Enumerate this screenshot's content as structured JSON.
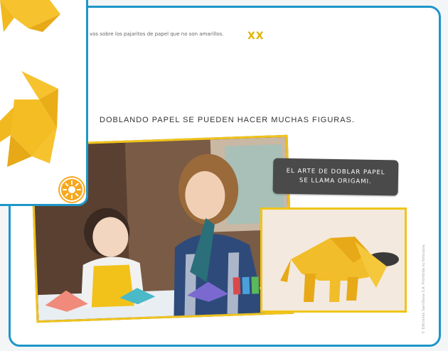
{
  "instruction": {
    "text": "vos sobre los pajaritos de papel que no son amarillos.",
    "answer_marks": "XX"
  },
  "headline": "DOBLANDO PAPEL SE PUEDEN HACER MUCHAS FIGURAS.",
  "caption": {
    "line1": "EL ARTE DE DOBLAR PAPEL",
    "line2": "SE LLAMA ORIGAMI."
  },
  "credit": "© Ediciones Santillana S.A. Prohibida su fotocopia.",
  "colors": {
    "frame": "#1e96c8",
    "photo_border": "#f0c419",
    "caption_bg": "#4a4a4a",
    "answer_marks": "#e0b400",
    "badge": "#f7a81e"
  },
  "icons": {
    "badge": "sun-icon"
  }
}
